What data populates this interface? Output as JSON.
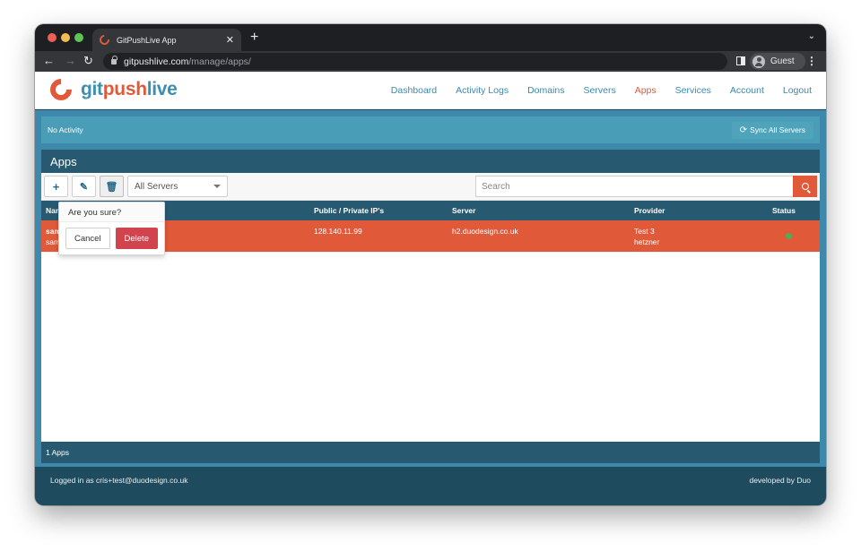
{
  "browser": {
    "tab_title": "GitPushLive App",
    "tab_close": "✕",
    "new_tab": "+",
    "tab_menu": "⌄",
    "url_host": "gitpushlive.com",
    "url_path": "/manage/apps/",
    "back": "←",
    "forward": "→",
    "reload": "↻",
    "profile_label": "Guest",
    "menu": "⋮"
  },
  "header": {
    "logo": {
      "part1": "git",
      "part2": "push",
      "part3": "live"
    },
    "nav": [
      {
        "label": "Dashboard",
        "active": false
      },
      {
        "label": "Activity Logs",
        "active": false
      },
      {
        "label": "Domains",
        "active": false
      },
      {
        "label": "Servers",
        "active": false
      },
      {
        "label": "Apps",
        "active": true
      },
      {
        "label": "Services",
        "active": false
      },
      {
        "label": "Account",
        "active": false
      },
      {
        "label": "Logout",
        "active": false
      }
    ]
  },
  "activity": {
    "status": "No Activity",
    "sync_icon": "⟳",
    "sync_label": "Sync All Servers"
  },
  "panel": {
    "title": "Apps",
    "tools": {
      "add": "+",
      "edit": "✎",
      "delete": "🗑"
    },
    "server_filter": "All Servers",
    "search_placeholder": "Search",
    "columns": {
      "name": "Name",
      "ips": "Public / Private IP's",
      "server": "Server",
      "provider": "Provider",
      "status": "Status"
    },
    "rows": [
      {
        "name": "sam",
        "name_sub": "sam...gle.com",
        "ip": "128.140.11.99",
        "server": "h2.duodesign.co.uk",
        "provider": "Test 3",
        "provider_sub": "hetzner",
        "status": "online"
      }
    ],
    "footer_count": "1 Apps"
  },
  "popover": {
    "title": "Are you sure?",
    "cancel": "Cancel",
    "delete": "Delete"
  },
  "footer": {
    "logged_in": "Logged in as cris+test@duodesign.co.uk",
    "credit": "developed by Duo"
  },
  "colors": {
    "brand_blue": "#3d88ab",
    "brand_orange": "#e05a3a",
    "dark_teal": "#275a70",
    "danger": "#d1434d",
    "status_ok": "#4caf50"
  }
}
